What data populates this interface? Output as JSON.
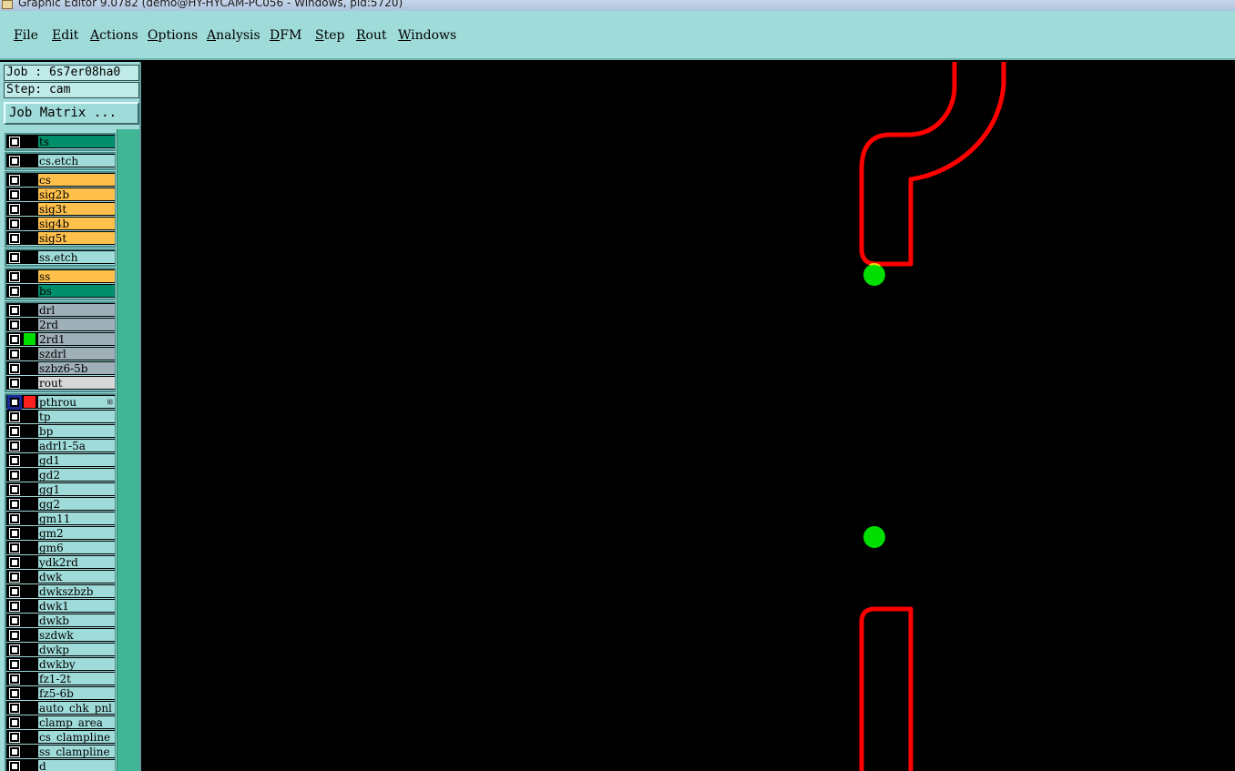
{
  "window": {
    "title": "Graphic Editor 9.0782 (demo@HY-HYCAM-PC056 - Windows, pid:5720)"
  },
  "menu": [
    {
      "label": "File",
      "mn": "F",
      "rest": "ile"
    },
    {
      "label": "Edit",
      "mn": "E",
      "rest": "dit"
    },
    {
      "label": "Actions",
      "mn": "A",
      "rest": "ctions"
    },
    {
      "label": "Options",
      "mn": "O",
      "rest": "ptions"
    },
    {
      "label": "Analysis",
      "mn": "A",
      "rest": "nalysis"
    },
    {
      "label": "DFM",
      "mn": "D",
      "rest": "FM"
    },
    {
      "label": "Step",
      "mn": "S",
      "rest": "tep"
    },
    {
      "label": "Rout",
      "mn": "R",
      "rest": "out"
    },
    {
      "label": "Windows",
      "mn": "W",
      "rest": "indows"
    }
  ],
  "panel": {
    "job": "Job : 6s7er08ha0",
    "step": "Step: cam",
    "matrix_button": "Job Matrix ..."
  },
  "colors": {
    "board": "#008f6a",
    "signal": "#ffc04c",
    "drill": "#9fb0b8",
    "rout": "#d8d8d8",
    "misc": "#9fdbd9",
    "work_layer": "#00ff00",
    "affected": "#ff2020",
    "trace": "#ff0000",
    "pad": "#00dd00"
  },
  "layers": [
    {
      "name": "ts",
      "color": "#008f6a",
      "swatch": "#000000",
      "checked": false,
      "group": 1
    },
    {
      "name": "cs.etch",
      "color": "#9fdbd9",
      "swatch": "#000000",
      "checked": false,
      "group": 2
    },
    {
      "name": "cs",
      "color": "#ffc04c",
      "swatch": "#000000",
      "checked": false,
      "group": 3
    },
    {
      "name": "sig2b",
      "color": "#ffc04c",
      "swatch": "#000000",
      "checked": false,
      "group": 3
    },
    {
      "name": "sig3t",
      "color": "#ffc04c",
      "swatch": "#000000",
      "checked": false,
      "group": 3
    },
    {
      "name": "sig4b",
      "color": "#ffc04c",
      "swatch": "#000000",
      "checked": false,
      "group": 3
    },
    {
      "name": "sig5t",
      "color": "#ffc04c",
      "swatch": "#000000",
      "checked": false,
      "group": 3
    },
    {
      "name": "ss.etch",
      "color": "#9fdbd9",
      "swatch": "#000000",
      "checked": false,
      "group": 4
    },
    {
      "name": "ss",
      "color": "#ffc04c",
      "swatch": "#000000",
      "checked": false,
      "group": 5
    },
    {
      "name": "bs",
      "color": "#008f6a",
      "swatch": "#000000",
      "checked": false,
      "group": 5
    },
    {
      "name": "drl",
      "color": "#9fb0b8",
      "swatch": "#000000",
      "checked": false,
      "group": 6
    },
    {
      "name": "2rd",
      "color": "#9fb0b8",
      "swatch": "#000000",
      "checked": false,
      "group": 6
    },
    {
      "name": "2rd1",
      "color": "#9fb0b8",
      "swatch": "#00dd00",
      "checked": false,
      "group": 6
    },
    {
      "name": "szdrl",
      "color": "#9fb0b8",
      "swatch": "#000000",
      "checked": false,
      "group": 6
    },
    {
      "name": "szbz6-5b",
      "color": "#9fb0b8",
      "swatch": "#000000",
      "checked": false,
      "group": 6
    },
    {
      "name": "rout",
      "color": "#d8d8d8",
      "swatch": "#000000",
      "checked": false,
      "group": 6
    },
    {
      "name": "pthrou",
      "color": "#9fdbd9",
      "swatch": "#ff2020",
      "checked": true,
      "group": 7,
      "affect": "⊞"
    },
    {
      "name": "tp",
      "color": "#9fdbd9",
      "swatch": "#000000",
      "checked": false,
      "group": 7
    },
    {
      "name": "bp",
      "color": "#9fdbd9",
      "swatch": "#000000",
      "checked": false,
      "group": 7
    },
    {
      "name": "adrl1-5a",
      "color": "#9fdbd9",
      "swatch": "#000000",
      "checked": false,
      "group": 7
    },
    {
      "name": "gd1",
      "color": "#9fdbd9",
      "swatch": "#000000",
      "checked": false,
      "group": 7
    },
    {
      "name": "gd2",
      "color": "#9fdbd9",
      "swatch": "#000000",
      "checked": false,
      "group": 7
    },
    {
      "name": "gg1",
      "color": "#9fdbd9",
      "swatch": "#000000",
      "checked": false,
      "group": 7
    },
    {
      "name": "gg2",
      "color": "#9fdbd9",
      "swatch": "#000000",
      "checked": false,
      "group": 7
    },
    {
      "name": "gm11",
      "color": "#9fdbd9",
      "swatch": "#000000",
      "checked": false,
      "group": 7
    },
    {
      "name": "gm2",
      "color": "#9fdbd9",
      "swatch": "#000000",
      "checked": false,
      "group": 7
    },
    {
      "name": "gm6",
      "color": "#9fdbd9",
      "swatch": "#000000",
      "checked": false,
      "group": 7
    },
    {
      "name": "ydk2rd",
      "color": "#9fdbd9",
      "swatch": "#000000",
      "checked": false,
      "group": 7
    },
    {
      "name": "dwk",
      "color": "#9fdbd9",
      "swatch": "#000000",
      "checked": false,
      "group": 7
    },
    {
      "name": "dwkszbzb",
      "color": "#9fdbd9",
      "swatch": "#000000",
      "checked": false,
      "group": 7
    },
    {
      "name": "dwk1",
      "color": "#9fdbd9",
      "swatch": "#000000",
      "checked": false,
      "group": 7
    },
    {
      "name": "dwkb",
      "color": "#9fdbd9",
      "swatch": "#000000",
      "checked": false,
      "group": 7
    },
    {
      "name": "szdwk",
      "color": "#9fdbd9",
      "swatch": "#000000",
      "checked": false,
      "group": 7
    },
    {
      "name": "dwkp",
      "color": "#9fdbd9",
      "swatch": "#000000",
      "checked": false,
      "group": 7
    },
    {
      "name": "dwkby",
      "color": "#9fdbd9",
      "swatch": "#000000",
      "checked": false,
      "group": 7
    },
    {
      "name": "fz1-2t",
      "color": "#9fdbd9",
      "swatch": "#000000",
      "checked": false,
      "group": 7
    },
    {
      "name": "fz5-6b",
      "color": "#9fdbd9",
      "swatch": "#000000",
      "checked": false,
      "group": 7
    },
    {
      "name": "auto_chk_pnl",
      "color": "#9fdbd9",
      "swatch": "#000000",
      "checked": false,
      "group": 7
    },
    {
      "name": "clamp_area",
      "color": "#9fdbd9",
      "swatch": "#000000",
      "checked": false,
      "group": 7
    },
    {
      "name": "cs_clampline",
      "color": "#9fdbd9",
      "swatch": "#000000",
      "checked": false,
      "group": 7
    },
    {
      "name": "ss_clampline",
      "color": "#9fdbd9",
      "swatch": "#000000",
      "checked": false,
      "group": 7
    },
    {
      "name": "d",
      "color": "#9fdbd9",
      "swatch": "#000000",
      "checked": false,
      "group": 7
    }
  ],
  "canvas": {
    "background": "#000000"
  }
}
